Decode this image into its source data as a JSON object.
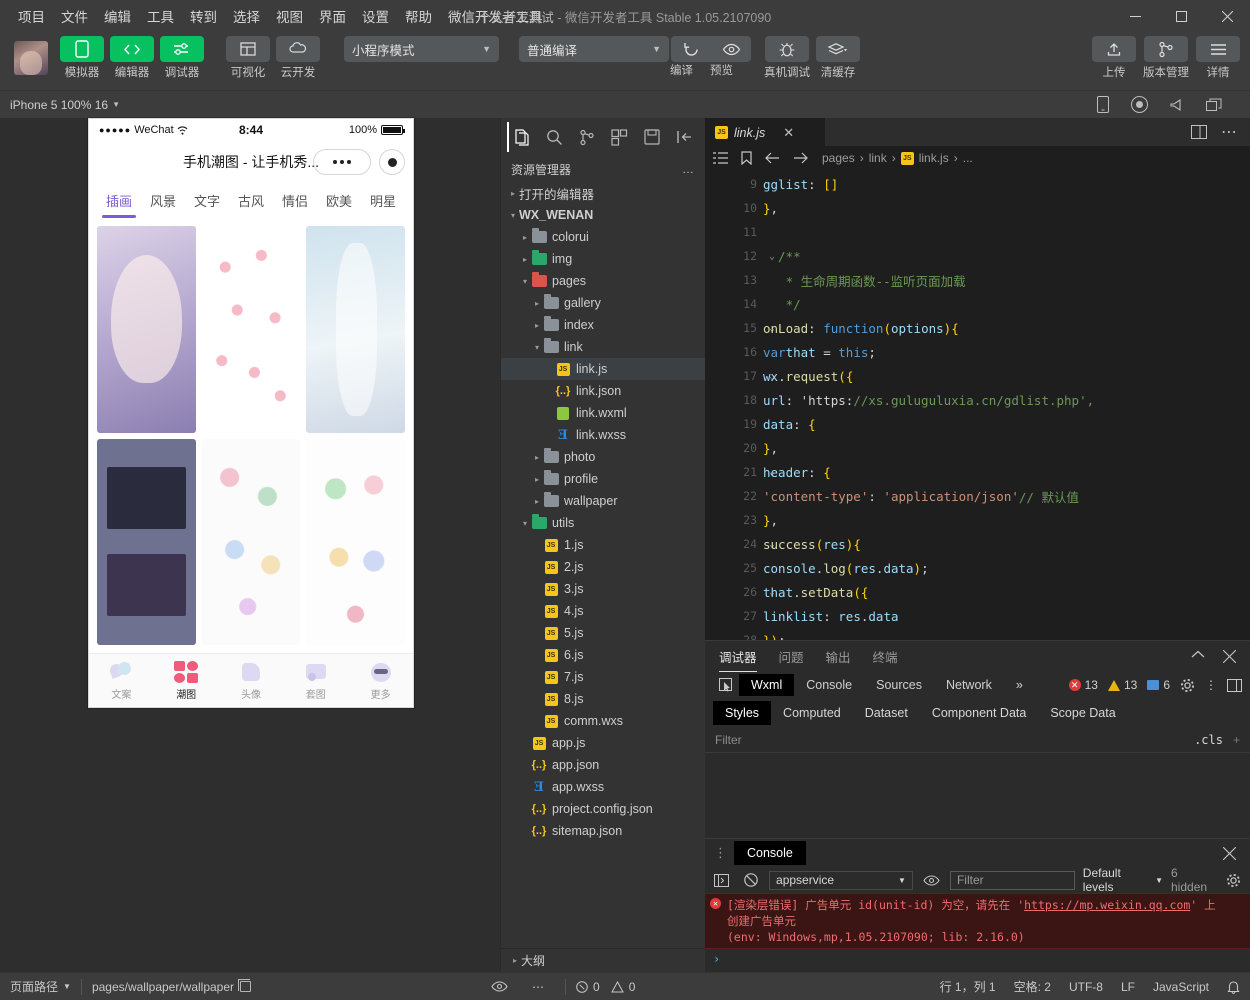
{
  "titlebar": {
    "menus": [
      "项目",
      "文件",
      "编辑",
      "工具",
      "转到",
      "选择",
      "视图",
      "界面",
      "设置",
      "帮助",
      "微信开发者工具"
    ],
    "project_name": "个人开发测试",
    "separator": "-",
    "app_name": "微信开发者工具",
    "version": "Stable 1.05.2107090",
    "minimize": "–",
    "maximize": "▢",
    "close": "✕"
  },
  "toolbar": {
    "buttons": [
      {
        "label": "模拟器",
        "icon": "phone-icon",
        "style": "green"
      },
      {
        "label": "编辑器",
        "icon": "code-icon",
        "style": "green"
      },
      {
        "label": "调试器",
        "icon": "sliders-icon",
        "style": "green"
      },
      {
        "label": "可视化",
        "icon": "layout-icon",
        "style": "grey"
      },
      {
        "label": "云开发",
        "icon": "cloud-icon",
        "style": "grey"
      }
    ],
    "mode_select": "小程序模式",
    "compile_select": "普通编译",
    "compile_label": "编译",
    "preview_label": "预览",
    "realdevice_label": "真机调试",
    "cache_label": "清缓存",
    "upload_label": "上传",
    "version_label": "版本管理",
    "details_label": "详情"
  },
  "simbar": {
    "device": "iPhone 5 100% 16",
    "icons": [
      "phone-icon",
      "record-icon",
      "volume-icon",
      "window-icon"
    ]
  },
  "phone": {
    "carrier": "WeChat",
    "signal_dots": "●●●●●",
    "time": "8:44",
    "battery_percent": "100%",
    "nav_title": "手机潮图 - 让手机秀...",
    "tabs": [
      "插画",
      "风景",
      "文字",
      "古风",
      "情侣",
      "欧美",
      "明星"
    ],
    "active_tab": "插画",
    "tabbar": [
      {
        "label": "文案",
        "icon": "hearts-icon",
        "active": false
      },
      {
        "label": "潮图",
        "icon": "grid-icon",
        "active": true
      },
      {
        "label": "头像",
        "icon": "avatar-icon",
        "active": false
      },
      {
        "label": "套图",
        "icon": "album-icon",
        "active": false
      },
      {
        "label": "更多",
        "icon": "more-icon",
        "active": false
      }
    ]
  },
  "explorer": {
    "activity_icons": [
      "files-icon",
      "search-icon",
      "source-control-icon",
      "extensions-icon",
      "save-icon",
      "collapse-icon"
    ],
    "title": "资源管理器",
    "more": "…",
    "open_editors": "打开的编辑器",
    "project_root": "WX_WENAN",
    "tree": [
      {
        "label": "colorui",
        "type": "folder",
        "depth": 1,
        "arrow": "▸",
        "color": "grey"
      },
      {
        "label": "img",
        "type": "folder",
        "depth": 1,
        "arrow": "▸",
        "color": "green"
      },
      {
        "label": "pages",
        "type": "folder",
        "depth": 1,
        "arrow": "▾",
        "color": "red"
      },
      {
        "label": "gallery",
        "type": "folder",
        "depth": 2,
        "arrow": "▸",
        "color": "grey"
      },
      {
        "label": "index",
        "type": "folder",
        "depth": 2,
        "arrow": "▸",
        "color": "grey"
      },
      {
        "label": "link",
        "type": "folder",
        "depth": 2,
        "arrow": "▾",
        "color": "grey"
      },
      {
        "label": "link.js",
        "type": "js",
        "depth": 3,
        "arrow": "",
        "selected": true
      },
      {
        "label": "link.json",
        "type": "json",
        "depth": 3,
        "arrow": ""
      },
      {
        "label": "link.wxml",
        "type": "wxml",
        "depth": 3,
        "arrow": ""
      },
      {
        "label": "link.wxss",
        "type": "wxss",
        "depth": 3,
        "arrow": ""
      },
      {
        "label": "photo",
        "type": "folder",
        "depth": 2,
        "arrow": "▸",
        "color": "grey"
      },
      {
        "label": "profile",
        "type": "folder",
        "depth": 2,
        "arrow": "▸",
        "color": "grey"
      },
      {
        "label": "wallpaper",
        "type": "folder",
        "depth": 2,
        "arrow": "▸",
        "color": "grey"
      },
      {
        "label": "utils",
        "type": "folder",
        "depth": 1,
        "arrow": "▾",
        "color": "green"
      },
      {
        "label": "1.js",
        "type": "js",
        "depth": 2,
        "arrow": ""
      },
      {
        "label": "2.js",
        "type": "js",
        "depth": 2,
        "arrow": ""
      },
      {
        "label": "3.js",
        "type": "js",
        "depth": 2,
        "arrow": ""
      },
      {
        "label": "4.js",
        "type": "js",
        "depth": 2,
        "arrow": ""
      },
      {
        "label": "5.js",
        "type": "js",
        "depth": 2,
        "arrow": ""
      },
      {
        "label": "6.js",
        "type": "js",
        "depth": 2,
        "arrow": ""
      },
      {
        "label": "7.js",
        "type": "js",
        "depth": 2,
        "arrow": ""
      },
      {
        "label": "8.js",
        "type": "js",
        "depth": 2,
        "arrow": ""
      },
      {
        "label": "comm.wxs",
        "type": "js",
        "depth": 2,
        "arrow": ""
      },
      {
        "label": "app.js",
        "type": "js",
        "depth": 1,
        "arrow": ""
      },
      {
        "label": "app.json",
        "type": "json",
        "depth": 1,
        "arrow": ""
      },
      {
        "label": "app.wxss",
        "type": "wxss",
        "depth": 1,
        "arrow": ""
      },
      {
        "label": "project.config.json",
        "type": "json",
        "depth": 1,
        "arrow": ""
      },
      {
        "label": "sitemap.json",
        "type": "json",
        "depth": 1,
        "arrow": ""
      }
    ],
    "outline": "大纲",
    "outline_errors": "0",
    "outline_warnings": "0"
  },
  "editor": {
    "tab_name": "link.js",
    "tab_icon": "js-icon",
    "tab_close": "✕",
    "breadcrumb": [
      "pages",
      "link",
      "link.js",
      "..."
    ],
    "lines": [
      {
        "num": "9",
        "fold": "",
        "text": "    gglist: []"
      },
      {
        "num": "10",
        "fold": "",
        "text": "  },"
      },
      {
        "num": "11",
        "fold": "",
        "text": ""
      },
      {
        "num": "12",
        "fold": "⌄",
        "text": "  /**"
      },
      {
        "num": "13",
        "fold": "",
        "text": "   * 生命周期函数--监听页面加载"
      },
      {
        "num": "14",
        "fold": "",
        "text": "   */"
      },
      {
        "num": "15",
        "fold": "⌄",
        "text": "  onLoad: function (options) {"
      },
      {
        "num": "16",
        "fold": "",
        "text": "    var that = this;"
      },
      {
        "num": "17",
        "fold": "⌄",
        "text": "    wx.request({"
      },
      {
        "num": "18",
        "fold": "",
        "text": "      url: 'https://xs.guluguluxia.cn/gdlist.php',"
      },
      {
        "num": "19",
        "fold": "",
        "text": "      data: {"
      },
      {
        "num": "20",
        "fold": "",
        "text": "      },"
      },
      {
        "num": "21",
        "fold": "⌄",
        "text": "      header: {"
      },
      {
        "num": "22",
        "fold": "",
        "text": "        'content-type': 'application/json' // 默认值"
      },
      {
        "num": "23",
        "fold": "",
        "text": "      },"
      },
      {
        "num": "24",
        "fold": "⌄",
        "text": "      success(res) {"
      },
      {
        "num": "25",
        "fold": "",
        "text": "        console.log(res.data);"
      },
      {
        "num": "26",
        "fold": "⌄",
        "text": "        that.setData({"
      },
      {
        "num": "27",
        "fold": "",
        "text": "          linklist: res.data"
      },
      {
        "num": "28",
        "fold": "",
        "text": "        });"
      },
      {
        "num": "29",
        "fold": "",
        "text": "      }"
      },
      {
        "num": "30",
        "fold": "",
        "text": "    })"
      }
    ]
  },
  "devtools": {
    "panel_tabs": [
      "调试器",
      "问题",
      "输出",
      "终端"
    ],
    "panel_active": "调试器",
    "collapse_icon": "chevron-up-icon",
    "close_icon": "close-icon",
    "inner_tabs": [
      "Wxml",
      "Console",
      "Sources",
      "Network"
    ],
    "inner_active": "Wxml",
    "more_tabs": "»",
    "errors": "13",
    "warnings": "13",
    "info": "6",
    "settings_icon": "gear-icon",
    "kebab_icon": "kebab-icon",
    "dock_icon": "dock-icon",
    "style_tabs": [
      "Styles",
      "Computed",
      "Dataset",
      "Component Data",
      "Scope Data"
    ],
    "style_active": "Styles",
    "filter_placeholder": "Filter",
    "cls_label": ".cls",
    "plus_label": "+"
  },
  "console": {
    "tab_label": "Console",
    "close_icon": "close-icon",
    "sidebar_icon": "sidebar-icon",
    "clear_icon": "clear-icon",
    "context": "appservice",
    "eye_icon": "eye-icon",
    "filter_placeholder": "Filter",
    "levels": "Default levels",
    "hidden": "6 hidden",
    "gear_icon": "gear-icon",
    "error_line1_a": "[渲染层错误] 广告单元 id(unit-id) 为空，请先在 '",
    "error_link": "https://mp.weixin.qq.com",
    "error_line1_b": "' 上",
    "error_line2": "创建广告单元",
    "error_line3": "(env: Windows,mp,1.05.2107090; lib: 2.16.0)",
    "prompt": "›"
  },
  "statusbar": {
    "path_label": "页面路径",
    "path_value": "pages/wallpaper/wallpaper",
    "copy_icon": "copy-icon",
    "eye_icon": "eye-icon",
    "more_icon": "more-icon",
    "errors": "0",
    "warnings": "0",
    "cursor": "行 1，列 1",
    "spaces": "空格: 2",
    "encoding": "UTF-8",
    "eol": "LF",
    "language": "JavaScript",
    "bell_icon": "bell-icon"
  }
}
